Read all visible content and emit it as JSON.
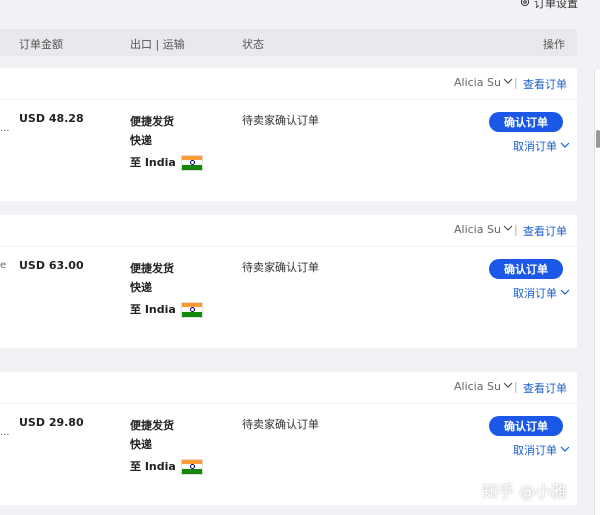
{
  "header": {
    "settings_label": "订单设置"
  },
  "table_header": {
    "amount": "订单金额",
    "shipping": "出口 | 运输",
    "status": "状态",
    "actions": "操作"
  },
  "orders": [
    {
      "owner": "Alicia Su",
      "separator": "|",
      "view_label": "查看订单",
      "left_text": "...",
      "amount": "USD 48.28",
      "ship_method": "便捷发货",
      "ship_speed": "快递",
      "destination": "至 India",
      "status": "待卖家确认订单",
      "confirm_label": "确认订单",
      "cancel_label": "取消订单"
    },
    {
      "owner": "Alicia Su",
      "separator": "|",
      "view_label": "查看订单",
      "left_text": "e",
      "amount": "USD 63.00",
      "ship_method": "便捷发货",
      "ship_speed": "快递",
      "destination": "至 India",
      "status": "待卖家确认订单",
      "confirm_label": "确认订单",
      "cancel_label": "取消订单"
    },
    {
      "owner": "Alicia Su",
      "separator": "|",
      "view_label": "查看订单",
      "left_text": "...",
      "amount": "USD 29.80",
      "ship_method": "便捷发货",
      "ship_speed": "快递",
      "destination": "至 India",
      "status": "待卖家确认订单",
      "confirm_label": "确认订单",
      "cancel_label": "取消订单"
    }
  ],
  "watermark": "知乎 @小雅",
  "colors": {
    "primary": "#1b58e8",
    "link": "#1b5fd1",
    "background": "#f1f2f5"
  }
}
